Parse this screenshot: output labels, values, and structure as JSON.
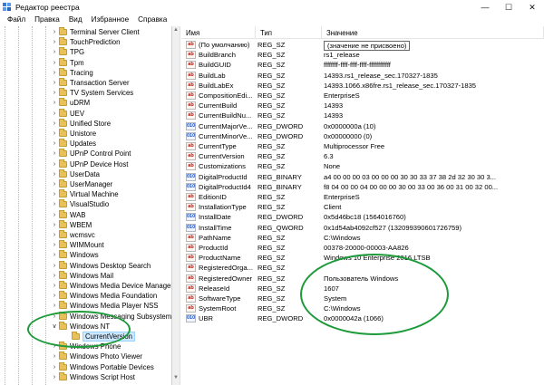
{
  "window": {
    "title": "Редактор реестра",
    "controls": [
      "—",
      "☐",
      "✕"
    ]
  },
  "menu": [
    "Файл",
    "Правка",
    "Вид",
    "Избранное",
    "Справка"
  ],
  "tree": {
    "items": [
      {
        "label": "Terminal Server Client"
      },
      {
        "label": "TouchPrediction"
      },
      {
        "label": "TPG"
      },
      {
        "label": "Tpm"
      },
      {
        "label": "Tracing"
      },
      {
        "label": "Transaction Server"
      },
      {
        "label": "TV System Services"
      },
      {
        "label": "uDRM"
      },
      {
        "label": "UEV"
      },
      {
        "label": "Unified Store"
      },
      {
        "label": "Unistore"
      },
      {
        "label": "Updates"
      },
      {
        "label": "UPnP Control Point"
      },
      {
        "label": "UPnP Device Host"
      },
      {
        "label": "UserData"
      },
      {
        "label": "UserManager"
      },
      {
        "label": "Virtual Machine"
      },
      {
        "label": "VisualStudio"
      },
      {
        "label": "WAB"
      },
      {
        "label": "WBEM"
      },
      {
        "label": "wcmsvc"
      },
      {
        "label": "WIMMount"
      },
      {
        "label": "Windows"
      },
      {
        "label": "Windows Desktop Search"
      },
      {
        "label": "Windows Mail"
      },
      {
        "label": "Windows Media Device Manager"
      },
      {
        "label": "Windows Media Foundation"
      },
      {
        "label": "Windows Media Player NSS"
      },
      {
        "label": "Windows Messaging Subsystem"
      },
      {
        "label": "Windows NT",
        "expanded": true
      },
      {
        "label": "CurrentVersion",
        "selected": true
      },
      {
        "label": "Windows Phone"
      },
      {
        "label": "Windows Photo Viewer"
      },
      {
        "label": "Windows Portable Devices"
      },
      {
        "label": "Windows Script Host"
      }
    ]
  },
  "values": {
    "headers": {
      "name": "Имя",
      "type": "Тип",
      "data": "Значение"
    },
    "rows": [
      {
        "name": "(По умолчанию)",
        "type": "REG_SZ",
        "data": "(значение не присвоено)",
        "icon": "string-value-icon",
        "default": true
      },
      {
        "name": "BuildBranch",
        "type": "REG_SZ",
        "data": "rs1_release",
        "icon": "string-value-icon"
      },
      {
        "name": "BuildGUID",
        "type": "REG_SZ",
        "data": "ffffffff-ffff-ffff-ffff-ffffffffffff",
        "icon": "string-value-icon"
      },
      {
        "name": "BuildLab",
        "type": "REG_SZ",
        "data": "14393.rs1_release_sec.170327-1835",
        "icon": "string-value-icon"
      },
      {
        "name": "BuildLabEx",
        "type": "REG_SZ",
        "data": "14393.1066.x86fre.rs1_release_sec.170327-1835",
        "icon": "string-value-icon"
      },
      {
        "name": "CompositionEdi...",
        "type": "REG_SZ",
        "data": "EnterpriseS",
        "icon": "string-value-icon"
      },
      {
        "name": "CurrentBuild",
        "type": "REG_SZ",
        "data": "14393",
        "icon": "string-value-icon"
      },
      {
        "name": "CurrentBuildNu...",
        "type": "REG_SZ",
        "data": "14393",
        "icon": "string-value-icon"
      },
      {
        "name": "CurrentMajorVe...",
        "type": "REG_DWORD",
        "data": "0x0000000a (10)",
        "icon": "binary-value-icon"
      },
      {
        "name": "CurrentMinorVe...",
        "type": "REG_DWORD",
        "data": "0x00000000 (0)",
        "icon": "binary-value-icon"
      },
      {
        "name": "CurrentType",
        "type": "REG_SZ",
        "data": "Multiprocessor Free",
        "icon": "string-value-icon"
      },
      {
        "name": "CurrentVersion",
        "type": "REG_SZ",
        "data": "6.3",
        "icon": "string-value-icon"
      },
      {
        "name": "Customizations",
        "type": "REG_SZ",
        "data": "None",
        "icon": "string-value-icon"
      },
      {
        "name": "DigitalProductId",
        "type": "REG_BINARY",
        "data": "a4 00 00 00 03 00 00 00 30 30 33 37 38 2d 32 30 30 3...",
        "icon": "binary-value-icon"
      },
      {
        "name": "DigitalProductId4",
        "type": "REG_BINARY",
        "data": "f8 04 00 00 04 00 00 00 30 00 33 00 36 00 31 00 32 00...",
        "icon": "binary-value-icon"
      },
      {
        "name": "EditionID",
        "type": "REG_SZ",
        "data": "EnterpriseS",
        "icon": "string-value-icon"
      },
      {
        "name": "InstallationType",
        "type": "REG_SZ",
        "data": "Client",
        "icon": "string-value-icon"
      },
      {
        "name": "InstallDate",
        "type": "REG_DWORD",
        "data": "0x5d46bc18 (1564016760)",
        "icon": "binary-value-icon"
      },
      {
        "name": "InstallTime",
        "type": "REG_QWORD",
        "data": "0x1d54ab4092cf527 (132099390601726759)",
        "icon": "binary-value-icon"
      },
      {
        "name": "PathName",
        "type": "REG_SZ",
        "data": "C:\\Windows",
        "icon": "string-value-icon"
      },
      {
        "name": "ProductId",
        "type": "REG_SZ",
        "data": "00378-20000-00003-AA826",
        "icon": "string-value-icon"
      },
      {
        "name": "ProductName",
        "type": "REG_SZ",
        "data": "Windows 10 Enterprise 2016 LTSB",
        "icon": "string-value-icon"
      },
      {
        "name": "RegisteredOrga...",
        "type": "REG_SZ",
        "data": "",
        "icon": "string-value-icon"
      },
      {
        "name": "RegisteredOwner",
        "type": "REG_SZ",
        "data": "Пользователь Windows",
        "icon": "string-value-icon"
      },
      {
        "name": "ReleaseId",
        "type": "REG_SZ",
        "data": "1607",
        "icon": "string-value-icon"
      },
      {
        "name": "SoftwareType",
        "type": "REG_SZ",
        "data": "System",
        "icon": "string-value-icon"
      },
      {
        "name": "SystemRoot",
        "type": "REG_SZ",
        "data": "C:\\Windows",
        "icon": "string-value-icon"
      },
      {
        "name": "UBR",
        "type": "REG_DWORD",
        "data": "0x0000042a (1066)",
        "icon": "binary-value-icon"
      }
    ]
  },
  "annotation_color": "#1d9a3a"
}
